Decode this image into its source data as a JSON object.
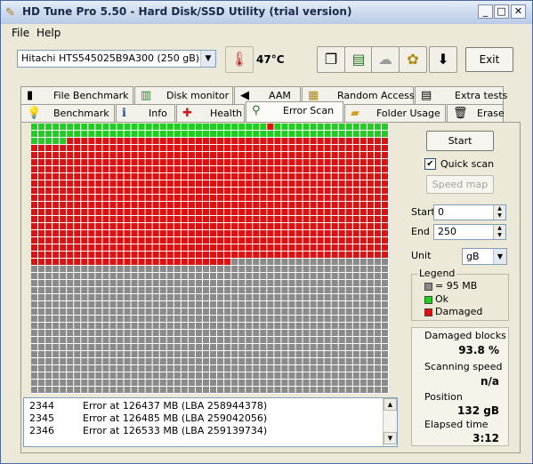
{
  "window": {
    "title": "HD Tune Pro 5.50 - Hard Disk/SSD Utility (trial version)",
    "controls": {
      "minimize": "_",
      "maximize": "□",
      "close": "✕"
    }
  },
  "menu": {
    "file": "File",
    "help": "Help"
  },
  "toolbar": {
    "drive": "Hitachi HTS545025B9A300 (250 gB)",
    "temperature": "47°C",
    "exit_label": "Exit",
    "icons": [
      "thermometer-icon",
      "copy-icon",
      "save-icon",
      "screenshot-icon",
      "options-icon",
      "download-icon"
    ]
  },
  "tabs_top": [
    {
      "label": "File Benchmark",
      "icon": "file-benchmark-icon"
    },
    {
      "label": "Disk monitor",
      "icon": "disk-monitor-icon"
    },
    {
      "label": "AAM",
      "icon": "speaker-icon"
    },
    {
      "label": "Random Access",
      "icon": "random-access-icon"
    },
    {
      "label": "Extra tests",
      "icon": "extra-tests-icon"
    }
  ],
  "tabs_bottom": [
    {
      "label": "Benchmark",
      "icon": "lightbulb-icon"
    },
    {
      "label": "Info",
      "icon": "info-icon"
    },
    {
      "label": "Health",
      "icon": "health-cross-icon"
    },
    {
      "label": "Error Scan",
      "icon": "magnifier-icon",
      "active": true
    },
    {
      "label": "Folder Usage",
      "icon": "folder-icon"
    },
    {
      "label": "Erase",
      "icon": "trash-icon"
    }
  ],
  "scan_map": {
    "columns": 50,
    "rows": 38,
    "ok_color": "#22cc22",
    "damaged_color": "#dd1111",
    "unscanned_color": "#8a8a8a",
    "ok_full_rows": 2,
    "ok_partial_cells_row3": 5,
    "damaged_cell_in_row1": 33,
    "damaged_end_row": 19,
    "damaged_partial_cells_last_row": 28
  },
  "log": {
    "rows": [
      {
        "id": "2344",
        "msg": "Error at 126437 MB (LBA 258944378)"
      },
      {
        "id": "2345",
        "msg": "Error at 126485 MB (LBA 259042056)"
      },
      {
        "id": "2346",
        "msg": "Error at 126533 MB (LBA 259139734)"
      }
    ]
  },
  "controls": {
    "start_label": "Start",
    "quick_scan_label": "Quick scan",
    "quick_scan_checked": true,
    "speed_map_label": "Speed map",
    "start_field_label": "Start",
    "start_value": "0",
    "end_field_label": "End",
    "end_value": "250",
    "unit_label": "Unit",
    "unit_value": "gB"
  },
  "legend": {
    "title": "Legend",
    "block_size": "= 95 MB",
    "ok": "Ok",
    "damaged": "Damaged",
    "block_color": "#8a8a8a",
    "ok_color": "#22cc22",
    "damaged_color": "#dd1111"
  },
  "stats": {
    "damaged_blocks_label": "Damaged blocks",
    "damaged_blocks_value": "93.8 %",
    "scanning_speed_label": "Scanning speed",
    "scanning_speed_value": "n/a",
    "position_label": "Position",
    "position_value": "132 gB",
    "elapsed_label": "Elapsed time",
    "elapsed_value": "3:12"
  }
}
